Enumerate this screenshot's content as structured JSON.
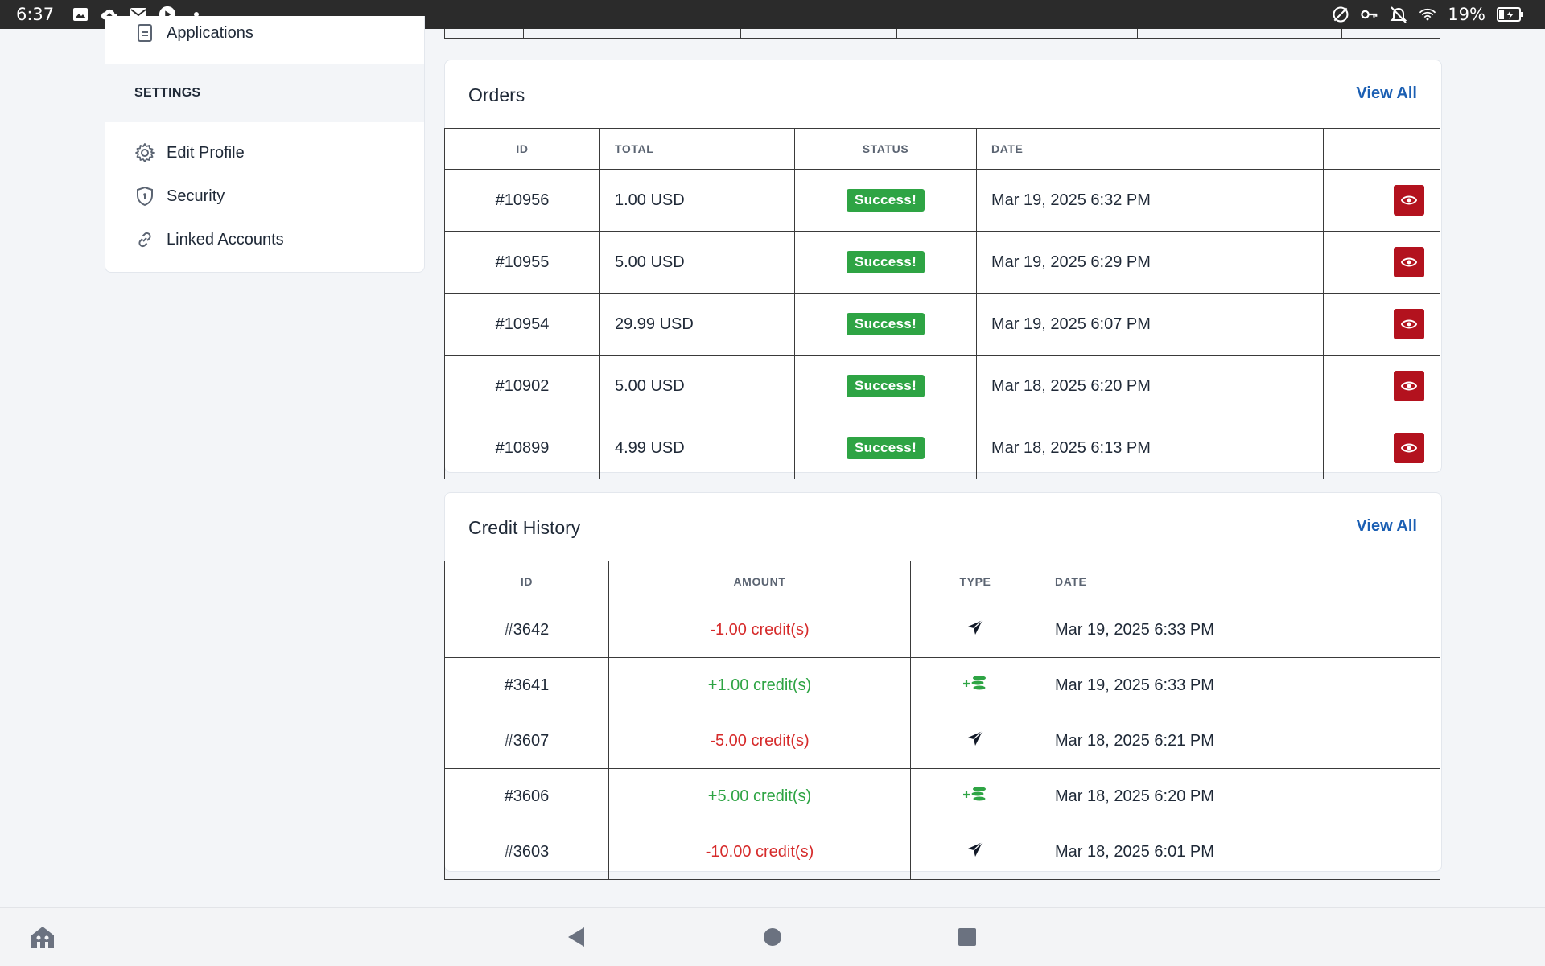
{
  "status_bar": {
    "time": "6:37",
    "battery": "19%"
  },
  "sidebar": {
    "top_item": "Applications",
    "section_heading": "SETTINGS",
    "items": [
      {
        "label": "Edit Profile",
        "icon": "gear-icon"
      },
      {
        "label": "Security",
        "icon": "shield-icon"
      },
      {
        "label": "Linked Accounts",
        "icon": "link-icon"
      }
    ]
  },
  "orders": {
    "title": "Orders",
    "view_all": "View All",
    "columns": [
      "ID",
      "TOTAL",
      "STATUS",
      "DATE",
      ""
    ],
    "rows": [
      {
        "id": "#10956",
        "total": "1.00 USD",
        "status": "Success!",
        "date": "Mar 19, 2025 6:32 PM"
      },
      {
        "id": "#10955",
        "total": "5.00 USD",
        "status": "Success!",
        "date": "Mar 19, 2025 6:29 PM"
      },
      {
        "id": "#10954",
        "total": "29.99 USD",
        "status": "Success!",
        "date": "Mar 19, 2025 6:07 PM"
      },
      {
        "id": "#10902",
        "total": "5.00 USD",
        "status": "Success!",
        "date": "Mar 18, 2025 6:20 PM"
      },
      {
        "id": "#10899",
        "total": "4.99 USD",
        "status": "Success!",
        "date": "Mar 18, 2025 6:13 PM"
      }
    ]
  },
  "credit_history": {
    "title": "Credit History",
    "view_all": "View All",
    "columns": [
      "ID",
      "AMOUNT",
      "TYPE",
      "DATE"
    ],
    "rows": [
      {
        "id": "#3642",
        "amount": "-1.00 credit(s)",
        "type": "send-icon",
        "date": "Mar 19, 2025 6:33 PM"
      },
      {
        "id": "#3641",
        "amount": "+1.00 credit(s)",
        "type": "add-coins-icon",
        "date": "Mar 19, 2025 6:33 PM"
      },
      {
        "id": "#3607",
        "amount": "-5.00 credit(s)",
        "type": "send-icon",
        "date": "Mar 18, 2025 6:21 PM"
      },
      {
        "id": "#3606",
        "amount": "+5.00 credit(s)",
        "type": "add-coins-icon",
        "date": "Mar 18, 2025 6:20 PM"
      },
      {
        "id": "#3603",
        "amount": "-10.00 credit(s)",
        "type": "send-icon",
        "date": "Mar 18, 2025 6:01 PM"
      }
    ]
  },
  "colors": {
    "success": "#2ea444",
    "negative": "#d62b2b",
    "link": "#1b5fb3",
    "view_button": "#b3121e"
  }
}
